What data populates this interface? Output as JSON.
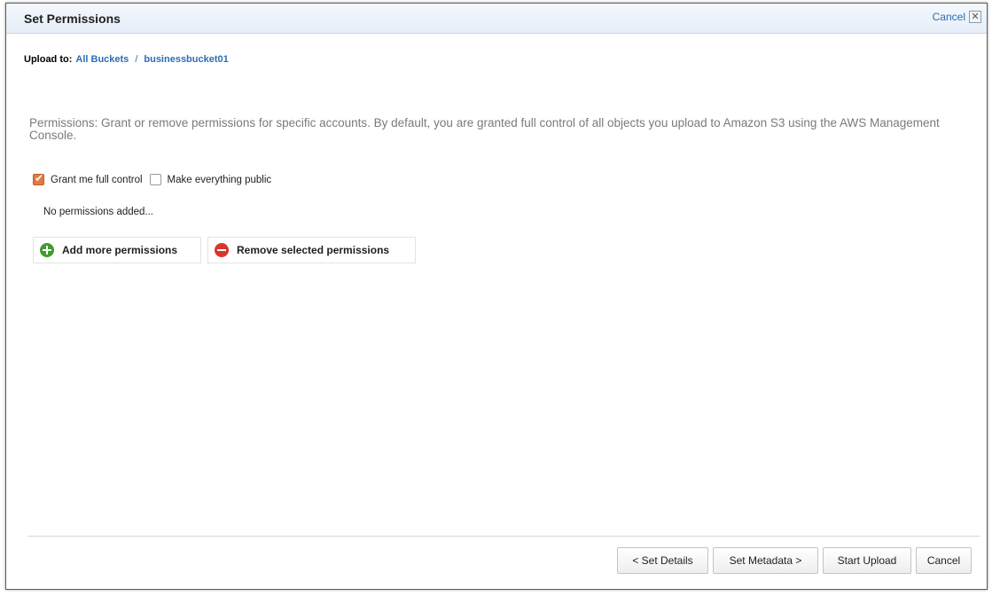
{
  "dialog": {
    "title": "Set Permissions",
    "cancel_label": "Cancel",
    "close_glyph": "✕"
  },
  "breadcrumb": {
    "label": "Upload to:",
    "items": [
      "All Buckets",
      "businessbucket01"
    ],
    "separator": "/"
  },
  "description": "Permissions: Grant or remove permissions for specific accounts. By default, you are granted full control of all objects you upload to Amazon S3 using the AWS Management Console.",
  "checkboxes": {
    "full_control": {
      "label": "Grant me full control",
      "checked": true
    },
    "public": {
      "label": "Make everything public",
      "checked": false
    }
  },
  "empty_message": "No permissions added...",
  "permission_buttons": {
    "add": "Add more permissions",
    "remove": "Remove selected permissions"
  },
  "footer": {
    "back": "< Set Details",
    "next": "Set Metadata >",
    "start": "Start Upload",
    "cancel": "Cancel"
  },
  "colors": {
    "link": "#2a6fb5",
    "checked_box": "#e2793f",
    "add_icon": "#3e9d2e",
    "remove_icon": "#d9362b"
  },
  "icons": {
    "add": "plus-circle-icon",
    "remove": "minus-circle-icon",
    "close": "close-icon"
  }
}
